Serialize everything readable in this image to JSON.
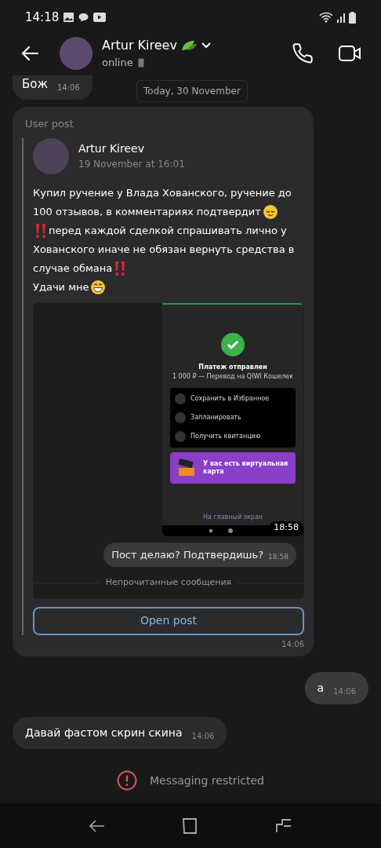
{
  "status_bar": {
    "time": "14:18"
  },
  "header": {
    "name": "Artur Kireev",
    "status": "online"
  },
  "messages_top": [
    {
      "text": "Бож",
      "time": "14:06"
    }
  ],
  "date_chip": "Today, 30 November",
  "shared_post": {
    "label": "User post",
    "author": "Artur Kireev",
    "date": "19 November at 16:01",
    "paragraphs": [
      [
        "Купил ручение у Влада Хованского, ручение до",
        "100 отзывов, в комментариях подтвердит"
      ],
      [
        "перед каждой сделкой спрашивать лично у",
        "Хованского иначе не обязан вернуть средства в",
        "случае обмана"
      ],
      [
        "Удачи мне"
      ]
    ],
    "attachment": {
      "title": "Платеж отправлен",
      "subtitle": "1 000 ₽ — Перевод на QIWI Кошелек",
      "actions": [
        "Сохранить в Избранное",
        "Запланировать",
        "Получить квитанцию"
      ],
      "promo": "У вас есть виртуальная карта",
      "home_link": "На главный экран",
      "screenshot_time": "18:58",
      "bubble": {
        "text": "Пост делаю? Подтвердишь?",
        "time": "18:58"
      },
      "divider": "Непрочитанные сообщения"
    },
    "button": "Open post",
    "time": "14:06"
  },
  "messages": [
    {
      "text": "а",
      "time": "14:06",
      "outgoing": true
    },
    {
      "text": "Давай фастом скрин скина",
      "time": "14:06",
      "outgoing": false
    }
  ],
  "notice": "Messaging restricted"
}
